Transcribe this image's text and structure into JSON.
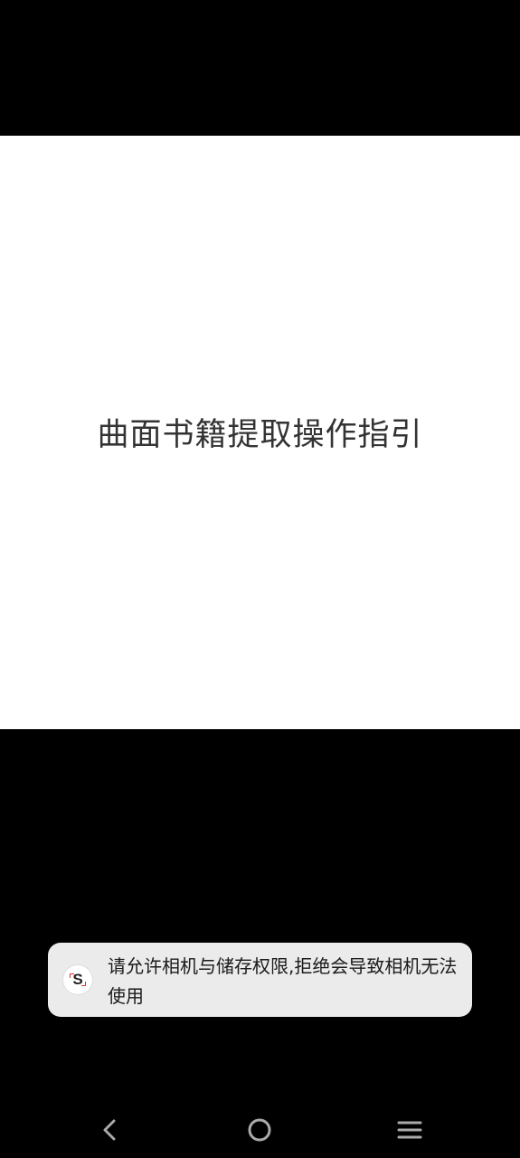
{
  "guide": {
    "title": "曲面书籍提取操作指引"
  },
  "toast": {
    "app_icon_letter": "S",
    "message": "请允许相机与储存权限,拒绝会导致相机无法使用"
  },
  "nav_bar": {
    "back_icon": "chevron-left-icon",
    "home_icon": "circle-home-icon",
    "menu_icon": "three-lines-menu-icon"
  },
  "colors": {
    "background": "#000000",
    "panel": "#ffffff",
    "title_text": "#333333",
    "toast_background": "#ebebeb",
    "toast_text": "#1a1a1a",
    "icon_accent": "#e0302b",
    "nav_icon": "#aaaaaa"
  }
}
